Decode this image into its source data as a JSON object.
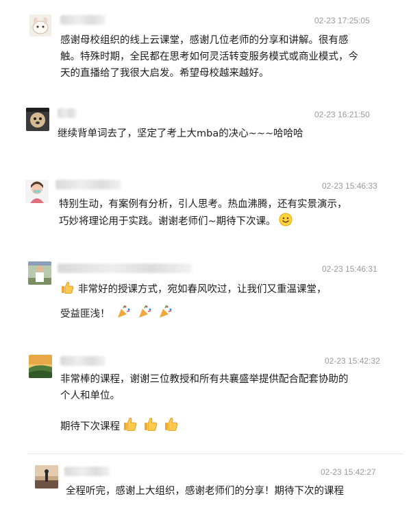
{
  "comments": [
    {
      "time": "02-23 17:25:05",
      "text": "感谢母校组织的线上云课堂，感谢几位老师的分享和讲解。很有感触。特殊时期，全民都在思考如何灵活转变服务模式或商业模式，今天的直播给了我很大启发。希望母校越来越好。"
    },
    {
      "time": "02-23 16:21:50",
      "text": "继续背单词去了，坚定了考上大mba的决心~~~哈哈哈"
    },
    {
      "time": "02-23 15:46:33",
      "text": "特别生动，有案例有分析，引人思考。热血沸腾，还有实景演示，巧妙将理论用于实践。谢谢老师们~期待下次课。",
      "emoji": "smile-emoji"
    },
    {
      "time": "02-23 15:46:31",
      "text_line1": "非常好的授课方式，宛如春风吹过，让我们又重温课堂，",
      "text_line2": "受益匪浅！",
      "lead_emoji": "thumbs-up-emoji",
      "trail_emoji": "party-popper-emoji"
    },
    {
      "time": "02-23 15:42:32",
      "text": "非常棒的课程，谢谢三位教授和所有共襄盛举提供配合配套协助的个人和单位。",
      "text2": "期待下次课程",
      "trail_emoji": "thumbs-up-emoji"
    },
    {
      "time": "02-23 15:42:27",
      "text": "全程听完，感谢上大组织，感谢老师们的分享！期待下次的课程"
    }
  ]
}
